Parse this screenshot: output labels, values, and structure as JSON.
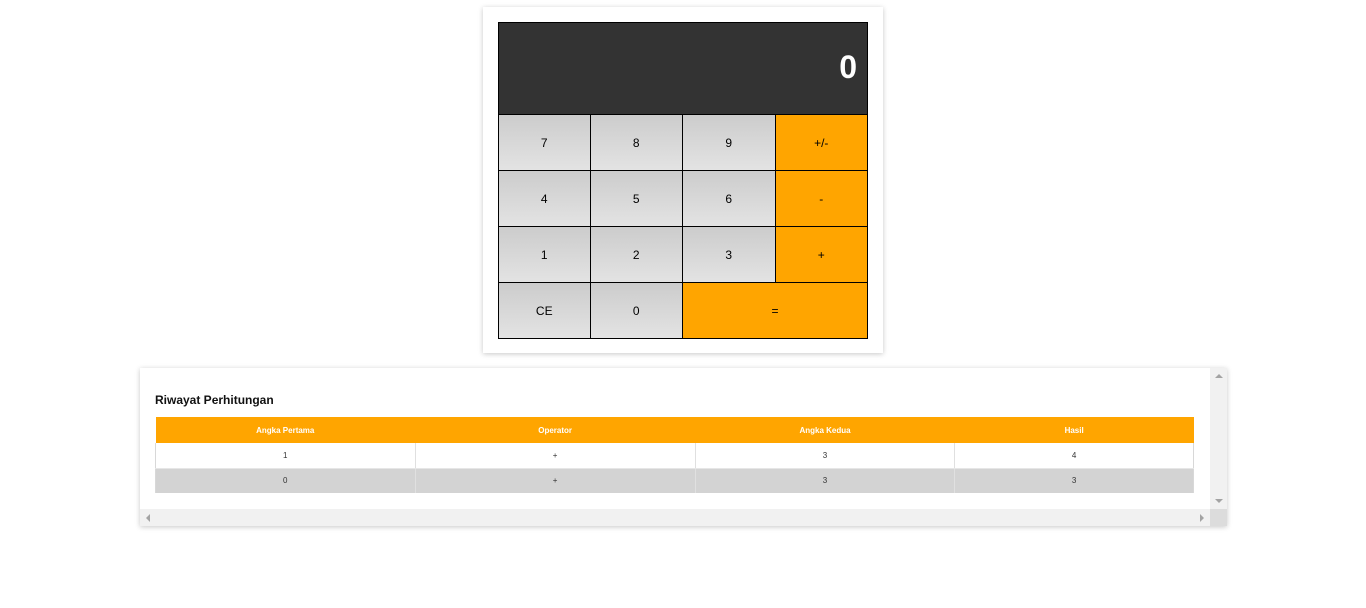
{
  "calculator": {
    "display_value": "0",
    "keys": [
      {
        "label": "7",
        "kind": "num"
      },
      {
        "label": "8",
        "kind": "num"
      },
      {
        "label": "9",
        "kind": "num"
      },
      {
        "label": "+/-",
        "kind": "op"
      },
      {
        "label": "4",
        "kind": "num"
      },
      {
        "label": "5",
        "kind": "num"
      },
      {
        "label": "6",
        "kind": "num"
      },
      {
        "label": "-",
        "kind": "op"
      },
      {
        "label": "1",
        "kind": "num"
      },
      {
        "label": "2",
        "kind": "num"
      },
      {
        "label": "3",
        "kind": "num"
      },
      {
        "label": "+",
        "kind": "op"
      },
      {
        "label": "CE",
        "kind": "num"
      },
      {
        "label": "0",
        "kind": "num"
      },
      {
        "label": "=",
        "kind": "eq"
      }
    ]
  },
  "history": {
    "title": "Riwayat Perhitungan",
    "columns": [
      "Angka Pertama",
      "Operator",
      "Angka Kedua",
      "Hasil"
    ],
    "rows": [
      [
        "1",
        "+",
        "3",
        "4"
      ],
      [
        "0",
        "+",
        "3",
        "3"
      ]
    ]
  },
  "colors": {
    "accent": "#ffa500",
    "display_bg": "#333333"
  }
}
